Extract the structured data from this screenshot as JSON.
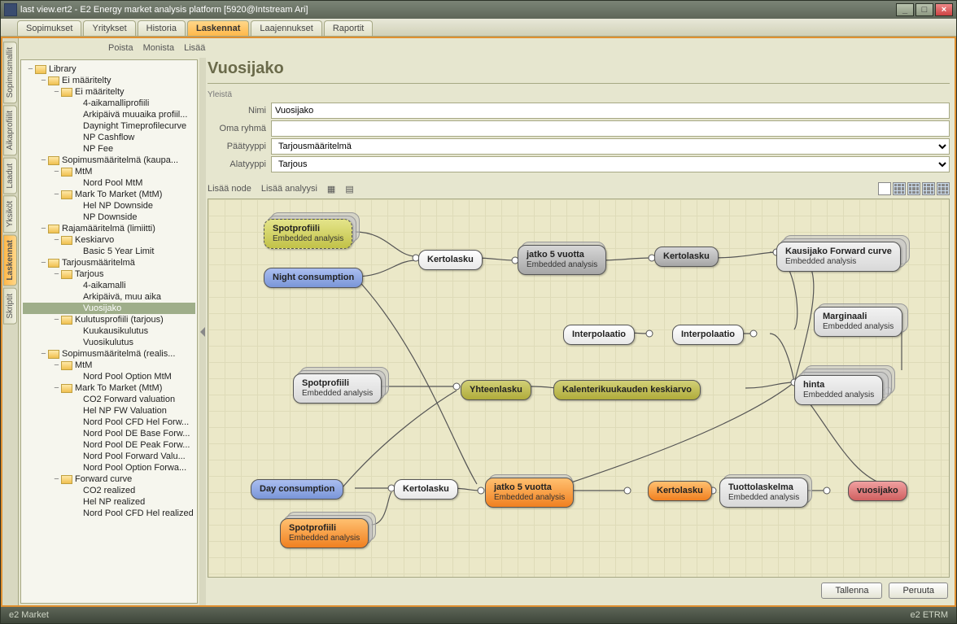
{
  "window": {
    "title": "last view.ert2 - E2 Energy market analysis platform [5920@Intstream Ari]"
  },
  "tabs": [
    "Sopimukset",
    "Yritykset",
    "Historia",
    "Laskennat",
    "Laajennukset",
    "Raportit"
  ],
  "active_tab": "Laskennat",
  "side_tabs": [
    "Sopimusmallit",
    "Aikaprofiilit",
    "Laadut",
    "Yksiköt",
    "Laskennat",
    "Skriptit"
  ],
  "active_side_tab": "Laskennat",
  "toolbar": {
    "poista": "Poista",
    "monista": "Monista",
    "lisaa": "Lisää"
  },
  "heading": "Vuosijako",
  "form": {
    "section": "Yleistä",
    "nimi_label": "Nimi",
    "nimi_value": "Vuosijako",
    "omaryhma_label": "Oma ryhmä",
    "omaryhma_value": "",
    "paatyyppi_label": "Päätyyppi",
    "paatyyppi_value": "Tarjousmääritelmä",
    "alatyyppi_label": "Alatyyppi",
    "alatyyppi_value": "Tarjous"
  },
  "nodebar": {
    "lisaa_node": "Lisää node",
    "lisaa_analyysi": "Lisää analyysi"
  },
  "tree": [
    {
      "d": 0,
      "f": true,
      "e": true,
      "l": "Library"
    },
    {
      "d": 1,
      "f": true,
      "e": true,
      "l": "Ei määritelty"
    },
    {
      "d": 2,
      "f": true,
      "e": true,
      "l": "Ei määritelty"
    },
    {
      "d": 3,
      "f": false,
      "l": "4-aikamalliprofiili"
    },
    {
      "d": 3,
      "f": false,
      "l": "Arkipäivä muuaika profiil..."
    },
    {
      "d": 3,
      "f": false,
      "l": "Daynight Timeprofilecurve"
    },
    {
      "d": 3,
      "f": false,
      "l": "NP Cashflow"
    },
    {
      "d": 3,
      "f": false,
      "l": "NP Fee"
    },
    {
      "d": 1,
      "f": true,
      "e": true,
      "l": "Sopimusmääritelmä (kaupa..."
    },
    {
      "d": 2,
      "f": true,
      "e": true,
      "l": "MtM"
    },
    {
      "d": 3,
      "f": false,
      "l": "Nord Pool MtM"
    },
    {
      "d": 2,
      "f": true,
      "e": true,
      "l": "Mark To Market (MtM)"
    },
    {
      "d": 3,
      "f": false,
      "l": "Hel NP Downside"
    },
    {
      "d": 3,
      "f": false,
      "l": "NP Downside"
    },
    {
      "d": 1,
      "f": true,
      "e": true,
      "l": "Rajamääritelmä (limiitti)"
    },
    {
      "d": 2,
      "f": true,
      "e": true,
      "l": "Keskiarvo"
    },
    {
      "d": 3,
      "f": false,
      "l": "Basic 5 Year Limit"
    },
    {
      "d": 1,
      "f": true,
      "e": true,
      "l": "Tarjousmääritelmä"
    },
    {
      "d": 2,
      "f": true,
      "e": true,
      "l": "Tarjous"
    },
    {
      "d": 3,
      "f": false,
      "l": "4-aikamalli"
    },
    {
      "d": 3,
      "f": false,
      "l": "Arkipäivä, muu aika"
    },
    {
      "d": 3,
      "f": false,
      "l": "Vuosijako",
      "sel": true
    },
    {
      "d": 2,
      "f": true,
      "e": true,
      "l": "Kulutusprofiili (tarjous)"
    },
    {
      "d": 3,
      "f": false,
      "l": "Kuukausikulutus"
    },
    {
      "d": 3,
      "f": false,
      "l": "Vuosikulutus"
    },
    {
      "d": 1,
      "f": true,
      "e": true,
      "l": "Sopimusmääritelmä (realis..."
    },
    {
      "d": 2,
      "f": true,
      "e": true,
      "l": "MtM"
    },
    {
      "d": 3,
      "f": false,
      "l": "Nord Pool Option MtM"
    },
    {
      "d": 2,
      "f": true,
      "e": true,
      "l": "Mark To Market (MtM)"
    },
    {
      "d": 3,
      "f": false,
      "l": "CO2 Forward valuation"
    },
    {
      "d": 3,
      "f": false,
      "l": "Hel NP FW Valuation"
    },
    {
      "d": 3,
      "f": false,
      "l": "Nord Pool CFD Hel Forw..."
    },
    {
      "d": 3,
      "f": false,
      "l": "Nord Pool DE Base Forw..."
    },
    {
      "d": 3,
      "f": false,
      "l": "Nord Pool DE Peak Forw..."
    },
    {
      "d": 3,
      "f": false,
      "l": "Nord Pool Forward Valu..."
    },
    {
      "d": 3,
      "f": false,
      "l": "Nord Pool Option Forwa..."
    },
    {
      "d": 2,
      "f": true,
      "e": true,
      "l": "Forward curve"
    },
    {
      "d": 3,
      "f": false,
      "l": "CO2 realized"
    },
    {
      "d": 3,
      "f": false,
      "l": "Hel NP realized"
    },
    {
      "d": 3,
      "f": false,
      "l": "Nord Pool CFD Hel realized"
    }
  ],
  "diagram": {
    "nodes": {
      "spot1": {
        "t": "Spotprofiili",
        "s": "Embedded analysis"
      },
      "night": {
        "t": "Night consumption"
      },
      "kert1": {
        "t": "Kertolasku"
      },
      "jatko1": {
        "t": "jatko 5 vuotta",
        "s": "Embedded analysis"
      },
      "kert2": {
        "t": "Kertolasku"
      },
      "kausi": {
        "t": "Kausijako Forward curve",
        "s": "Embedded analysis"
      },
      "spot2": {
        "t": "Spotprofiili",
        "s": "Embedded analysis"
      },
      "yht": {
        "t": "Yhteenlasku"
      },
      "kalkk": {
        "t": "Kalenterikuukauden keskiarvo"
      },
      "inter1": {
        "t": "Interpolaatio"
      },
      "inter2": {
        "t": "Interpolaatio"
      },
      "marg": {
        "t": "Marginaali",
        "s": "Embedded analysis"
      },
      "hinta": {
        "t": "hinta",
        "s": "Embedded analysis"
      },
      "day": {
        "t": "Day consumption"
      },
      "kert3": {
        "t": "Kertolasku"
      },
      "jatko2": {
        "t": "jatko 5 vuotta",
        "s": "Embedded analysis"
      },
      "kert4": {
        "t": "Kertolasku"
      },
      "tuotto": {
        "t": "Tuottolaskelma",
        "s": "Embedded analysis"
      },
      "vuosi": {
        "t": "vuosijako"
      },
      "spot3": {
        "t": "Spotprofiili",
        "s": "Embedded analysis"
      }
    }
  },
  "buttons": {
    "save": "Tallenna",
    "cancel": "Peruuta"
  },
  "status": {
    "left": "e2 Market",
    "right": "e2 ETRM"
  }
}
